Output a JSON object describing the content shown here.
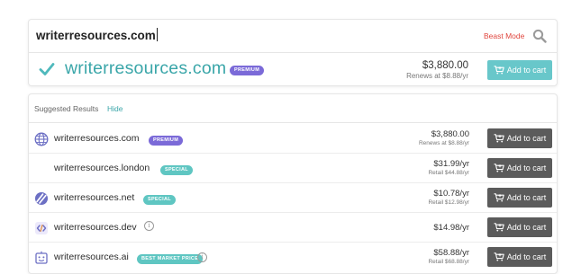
{
  "search": {
    "query": "writerresources.com",
    "beast_mode_label": "Beast Mode"
  },
  "hero": {
    "domain": "writerresources.com",
    "badge": "PREMIUM",
    "price": "$3,880.00",
    "renew": "Renews at $8.88/yr",
    "button_label": "Add to cart",
    "button_color": "#68c7ca"
  },
  "results": {
    "title": "Suggested Results",
    "hide_label": "Hide",
    "button_color": "#5b5b5b",
    "items": [
      {
        "icon": "globe-icon",
        "domain": "writerresources.com",
        "badge": "PREMIUM",
        "badge_type": "premium",
        "price": "$3,880.00",
        "sub": "Renews at $8.88/yr",
        "button_label": "Add to cart"
      },
      {
        "icon": "",
        "domain": "writerresources.london",
        "badge": "SPECIAL",
        "badge_type": "special",
        "price": "$31.99/yr",
        "sub": "Retail $44.88/yr",
        "button_label": "Add to cart"
      },
      {
        "icon": "net-logo-icon",
        "domain": "writerresources.net",
        "badge": "SPECIAL",
        "badge_type": "special",
        "price": "$10.78/yr",
        "sub": "Retail $12.98/yr",
        "button_label": "Add to cart"
      },
      {
        "icon": "code-brackets-icon",
        "domain": "writerresources.dev",
        "badge": "",
        "badge_type": "",
        "price": "$14.98/yr",
        "sub": "",
        "button_label": "Add to cart"
      },
      {
        "icon": "robot-face-icon",
        "domain": "writerresources.ai",
        "badge": "BEST MARKET PRICE",
        "badge_type": "best",
        "price": "$58.88/yr",
        "sub": "Retail $68.88/yr",
        "button_label": "Add to cart"
      }
    ]
  },
  "colors": {
    "accent_teal": "#3aa6a9",
    "premium_purple": "#7b6ad8",
    "special_teal": "#5fc6c2",
    "beast_mode_red": "#e0463e"
  }
}
